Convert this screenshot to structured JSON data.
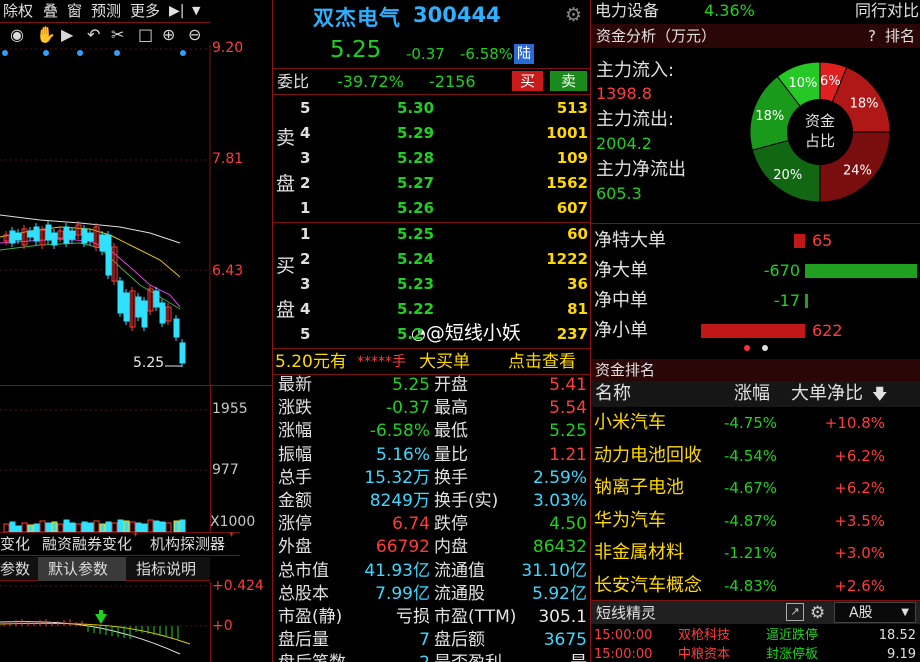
{
  "toolbar": {
    "items": [
      "除权",
      "叠",
      "窗",
      "预测",
      "更多"
    ]
  },
  "chart": {
    "price_labels": [
      "9.20",
      "7.81",
      "6.43"
    ],
    "last_price_label": "5.25",
    "volume_labels": [
      "1955",
      "977",
      "X1000"
    ],
    "indicator_labels": [
      "+0.424",
      "+0"
    ],
    "tabs": [
      "变化",
      "融资融券变化",
      "机构探测器"
    ],
    "param_tabs": [
      "参数",
      "默认参数",
      "指标说明"
    ]
  },
  "stock": {
    "name": "双杰电气",
    "code": "300444",
    "price": "5.25",
    "change": "-0.37",
    "change_pct": "-6.58%",
    "board_tag": "陆"
  },
  "weibi": {
    "label": "委比",
    "ratio": "-39.72%",
    "diff": "-2156",
    "buy_btn": "买",
    "sell_btn": "卖"
  },
  "sell_side": {
    "group_label": [
      "卖",
      "盘"
    ],
    "rows": [
      {
        "level": "5",
        "price": "5.30",
        "volume": "513"
      },
      {
        "level": "4",
        "price": "5.29",
        "volume": "1001"
      },
      {
        "level": "3",
        "price": "5.28",
        "volume": "109"
      },
      {
        "level": "2",
        "price": "5.27",
        "volume": "1562"
      },
      {
        "level": "1",
        "price": "5.26",
        "volume": "607"
      }
    ]
  },
  "buy_side": {
    "group_label": [
      "买",
      "盘"
    ],
    "rows": [
      {
        "level": "1",
        "price": "5.25",
        "volume": "60"
      },
      {
        "level": "2",
        "price": "5.24",
        "volume": "1222"
      },
      {
        "level": "3",
        "price": "5.23",
        "volume": "36"
      },
      {
        "level": "4",
        "price": "5.22",
        "volume": "81"
      },
      {
        "level": "5",
        "price": "5.2",
        "volume": "237"
      }
    ]
  },
  "big_order": {
    "left": "5.20元有",
    "stars": "*****手",
    "middle": "大买单",
    "link": "点击查看"
  },
  "quotes": [
    {
      "l1": "最新",
      "v1": "5.25",
      "l2": "开盘",
      "v2": "5.41",
      "c1": "green",
      "c2": "red"
    },
    {
      "l1": "涨跌",
      "v1": "-0.37",
      "l2": "最高",
      "v2": "5.54",
      "c1": "green",
      "c2": "red"
    },
    {
      "l1": "涨幅",
      "v1": "-6.58%",
      "l2": "最低",
      "v2": "5.25",
      "c1": "green",
      "c2": "green"
    },
    {
      "l1": "振幅",
      "v1": "5.16%",
      "l2": "量比",
      "v2": "1.21",
      "c1": "cyan",
      "c2": "red"
    },
    {
      "l1": "总手",
      "v1": "15.32万",
      "l2": "换手",
      "v2": "2.59%",
      "c1": "cyan",
      "c2": "cyan"
    },
    {
      "l1": "金额",
      "v1": "8249万",
      "l2": "换手(实)",
      "v2": "3.03%",
      "c1": "cyan",
      "c2": "cyan"
    },
    {
      "l1": "涨停",
      "v1": "6.74",
      "l2": "跌停",
      "v2": "4.50",
      "c1": "red",
      "c2": "green"
    },
    {
      "l1": "外盘",
      "v1": "66792",
      "l2": "内盘",
      "v2": "86432",
      "c1": "red",
      "c2": "green"
    },
    {
      "l1": "总市值",
      "v1": "41.93亿",
      "l2": "流通值",
      "v2": "31.10亿",
      "c1": "cyan",
      "c2": "cyan"
    },
    {
      "l1": "总股本",
      "v1": "7.99亿",
      "l2": "流通股",
      "v2": "5.92亿",
      "c1": "cyan",
      "c2": "cyan"
    },
    {
      "l1": "市盈(静)",
      "v1": "亏损",
      "l2": "市盈(TTM)",
      "v2": "305.1",
      "c1": "white",
      "c2": "white"
    },
    {
      "l1": "盘后量",
      "v1": "7",
      "l2": "盘后额",
      "v2": "3675",
      "c1": "cyan",
      "c2": "cyan"
    },
    {
      "l1": "盘后笔数",
      "v1": "2",
      "l2": "是否盈利",
      "v2": "是",
      "c1": "cyan",
      "c2": "white"
    }
  ],
  "sector": {
    "name": "电力设备",
    "pct": "4.36%",
    "compare": "同行对比"
  },
  "capital": {
    "title": "资金分析（万元）",
    "help": "?",
    "rank_btn": "排名",
    "inflow_label": "主力流入:",
    "inflow_value": "1398.8",
    "outflow_label": "主力流出:",
    "outflow_value": "2004.2",
    "net_label": "主力净流出",
    "net_value": "605.3",
    "donut_center": [
      "资金",
      "占比"
    ],
    "donut": [
      {
        "label": "6%",
        "value": 6,
        "color": "#e02020"
      },
      {
        "label": "18%",
        "value": 18,
        "color": "#b01818"
      },
      {
        "label": "24%",
        "value": 24,
        "color": "#7a0e0e"
      },
      {
        "label": "20%",
        "value": 20,
        "color": "#126812"
      },
      {
        "label": "18%",
        "value": 18,
        "color": "#1a9a1a"
      },
      {
        "label": "10%",
        "value": 10,
        "color": "#25c825"
      }
    ]
  },
  "netflow": [
    {
      "label": "净特大单",
      "value": "65",
      "sign": 1,
      "mag": 65
    },
    {
      "label": "净大单",
      "value": "-670",
      "sign": -1,
      "mag": 670
    },
    {
      "label": "净中单",
      "value": "-17",
      "sign": -1,
      "mag": 17
    },
    {
      "label": "净小单",
      "value": "622",
      "sign": 1,
      "mag": 622
    }
  ],
  "ranking": {
    "title": "资金排名",
    "headers": [
      "名称",
      "涨幅",
      "大单净比"
    ],
    "rows": [
      {
        "name": "小米汽车",
        "pct": "-4.75%",
        "net": "+10.8%"
      },
      {
        "name": "动力电池回收",
        "pct": "-4.54%",
        "net": "+6.2%"
      },
      {
        "name": "钠离子电池",
        "pct": "-4.67%",
        "net": "+6.2%"
      },
      {
        "name": "华为汽车",
        "pct": "-4.87%",
        "net": "+3.5%"
      },
      {
        "name": "非金属材料",
        "pct": "-1.21%",
        "net": "+3.0%"
      },
      {
        "name": "长安汽车概念",
        "pct": "-4.83%",
        "net": "+2.6%"
      }
    ]
  },
  "sprite": {
    "title": "短线精灵",
    "market": "A股",
    "rows": [
      {
        "time": "15:00:00",
        "name": "双枪科技",
        "event": "逼近跌停",
        "value": "18.52"
      },
      {
        "time": "15:00:00",
        "name": "中粮资本",
        "event": "封涨停板",
        "value": "9.19"
      }
    ]
  },
  "watermark": "@短线小妖"
}
